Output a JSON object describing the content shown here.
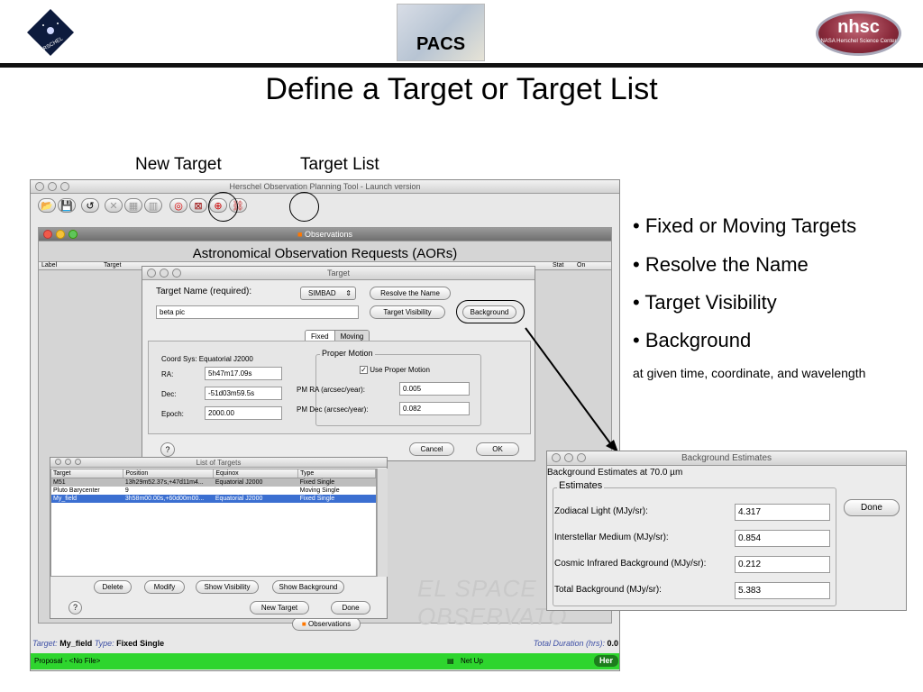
{
  "slide": {
    "title": "Define a Target or Target List",
    "logo_center": "PACS",
    "logo_right_big": "nhsc",
    "logo_right_small": "NASA Herschel Science Center",
    "logo_left": "HERSCHEL"
  },
  "annotations": {
    "new_target": "New Target",
    "target_list": "Target List"
  },
  "bullets": [
    "• Fixed or Moving Targets",
    "• Resolve the Name",
    "• Target Visibility",
    "• Background"
  ],
  "bullet_note": "at given time, coordinate, and wavelength",
  "app": {
    "title": "Herschel Observation Planning Tool - Launch version",
    "observations_title": "Observations",
    "aor_heading": "Astronomical Observation Requests (AORs)",
    "columns": [
      "Label",
      "Target",
      "Stat",
      "On"
    ],
    "status_target_label": "Target:",
    "status_target_value": "My_field",
    "status_type_label": "Type:",
    "status_type_value": "Fixed Single",
    "total_duration_label": "Total Duration (hrs):",
    "total_duration_value": "0.0",
    "proposal": "Proposal - <No File>",
    "net": "Net Up",
    "her": "Her",
    "observations_tab": "Observations",
    "watermark": "EL SPACE OBSERVATO"
  },
  "target_dialog": {
    "title": "Target",
    "name_label": "Target Name (required):",
    "resolver": "SIMBAD",
    "resolve_btn": "Resolve the Name",
    "name_value": "beta pic",
    "visibility_btn": "Target Visibility",
    "background_btn": "Background",
    "tab_fixed": "Fixed",
    "tab_moving": "Moving",
    "coord_sys": "Coord Sys: Equatorial J2000",
    "ra_label": "RA:",
    "ra_value": "5h47m17.09s",
    "dec_label": "Dec:",
    "dec_value": "-51d03m59.5s",
    "epoch_label": "Epoch:",
    "epoch_value": "2000.00",
    "pm_title": "Proper Motion",
    "use_pm": "Use Proper Motion",
    "pm_ra_label": "PM RA (arcsec/year):",
    "pm_ra_value": "0.005",
    "pm_dec_label": "PM Dec (arcsec/year):",
    "pm_dec_value": "0.082",
    "cancel": "Cancel",
    "ok": "OK",
    "help": "?"
  },
  "list_dialog": {
    "title": "List of Targets",
    "headers": [
      "Target",
      "Position",
      "Equinox",
      "Type"
    ],
    "rows": [
      [
        "M51",
        "13h29m52.37s,+47d11m4...",
        "Equatorial J2000",
        "Fixed Single"
      ],
      [
        "Pluto Barycenter",
        "9",
        "",
        "Moving Single"
      ],
      [
        "My_field",
        "3h58m00.00s,+60d00m00...",
        "Equatorial J2000",
        "Fixed Single"
      ]
    ],
    "delete": "Delete",
    "modify": "Modify",
    "show_visibility": "Show Visibility",
    "show_background": "Show Background",
    "new_target": "New Target",
    "done": "Done",
    "help": "?"
  },
  "background_dialog": {
    "title": "Background Estimates",
    "subtitle": "Background Estimates at 70.0 µm",
    "group": "Estimates",
    "rows": [
      [
        "Zodiacal Light (MJy/sr):",
        "4.317"
      ],
      [
        "Interstellar Medium (MJy/sr):",
        "0.854"
      ],
      [
        "Cosmic Infrared Background (MJy/sr):",
        "0.212"
      ],
      [
        "Total Background (MJy/sr):",
        "5.383"
      ]
    ],
    "done": "Done"
  }
}
